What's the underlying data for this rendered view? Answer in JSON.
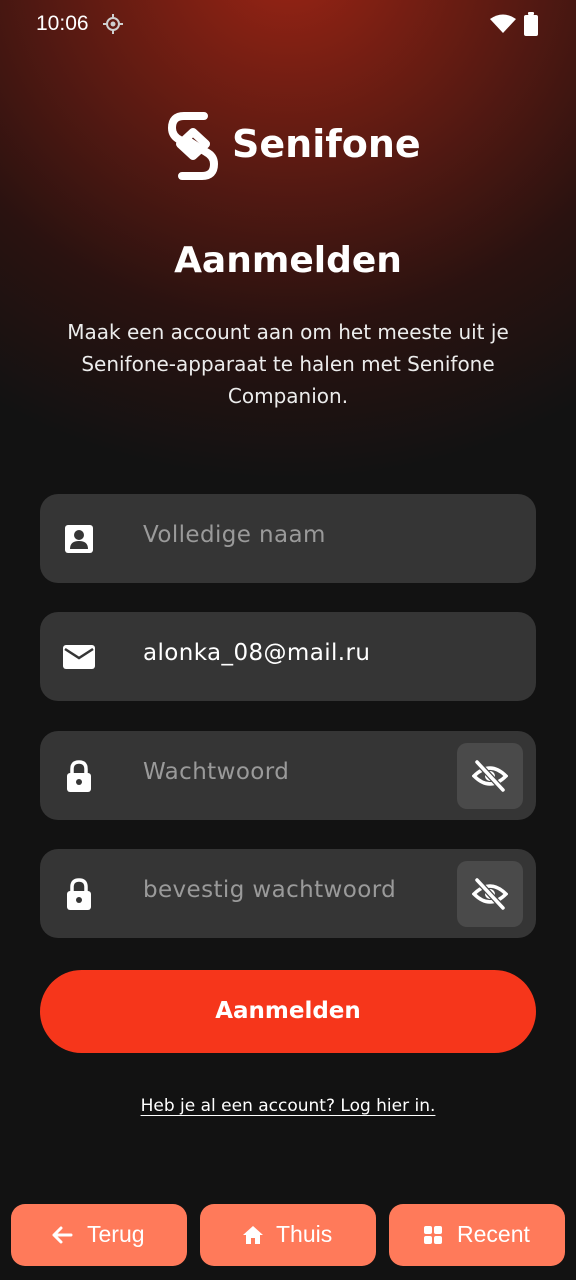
{
  "status_bar": {
    "time": "10:06",
    "icons": [
      "location-icon",
      "wifi-icon",
      "battery-icon"
    ]
  },
  "brand": {
    "name": "Senifone",
    "logo_icon": "senifone-logo-icon"
  },
  "page": {
    "title": "Aanmelden",
    "subtitle": "Maak een account aan om het meeste uit je Senifone-apparaat te halen met Senifone Companion."
  },
  "form": {
    "full_name": {
      "placeholder": "Volledige naam",
      "value": "",
      "icon": "person-card-icon"
    },
    "email": {
      "placeholder": "",
      "value": "alonka_08@mail.ru",
      "icon": "mail-icon"
    },
    "password": {
      "placeholder": "Wachtwoord",
      "value": "",
      "icon": "lock-icon",
      "toggle_icon": "eye-off-icon"
    },
    "confirm_password": {
      "placeholder": "bevestig wachtwoord",
      "value": "",
      "icon": "lock-icon",
      "toggle_icon": "eye-off-icon"
    },
    "submit_label": "Aanmelden",
    "login_link": "Heb je al een account? Log hier in."
  },
  "bottom_nav": {
    "back": "Terug",
    "home": "Thuis",
    "recent": "Recent"
  },
  "colors": {
    "accent": "#f6361b",
    "nav_button": "#ff7a5a",
    "field_bg": "#353535",
    "background": "#121212"
  }
}
